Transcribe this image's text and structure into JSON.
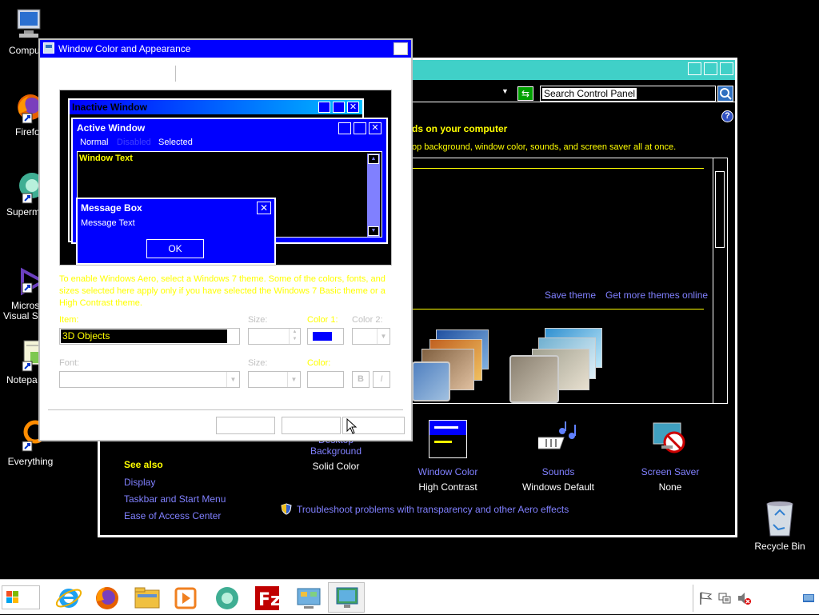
{
  "desktop": {
    "icons": [
      {
        "label": "Compu"
      },
      {
        "label": "Firefo"
      },
      {
        "label": "Superm"
      },
      {
        "label": "Micros"
      },
      {
        "label": "Visual S"
      },
      {
        "label": "Notepa"
      },
      {
        "label": "Everything"
      },
      {
        "label": "Recycle Bin"
      }
    ]
  },
  "control_panel": {
    "search_placeholder": "Search Control Panel",
    "heading_fragment": "ds on your computer",
    "subheading_fragment": "op background, window color, sounds, and screen saver all at once.",
    "save_theme": "Save theme",
    "get_more_themes": "Get more themes online",
    "see_also": {
      "title": "See also",
      "links": [
        "Display",
        "Taskbar and Start Menu",
        "Ease of Access Center"
      ]
    },
    "bottom_items": [
      {
        "title": "Desktop Background",
        "value": "Solid Color"
      },
      {
        "title": "Window Color",
        "value": "High Contrast"
      },
      {
        "title": "Sounds",
        "value": "Windows Default"
      },
      {
        "title": "Screen Saver",
        "value": "None"
      }
    ],
    "troubleshoot": "Troubleshoot problems with transparency and other Aero effects",
    "help_glyph": "?"
  },
  "dialog": {
    "title": "Window Color and Appearance",
    "preview": {
      "inactive_title": "Inactive Window",
      "active_title": "Active Window",
      "menu_normal": "Normal",
      "menu_disabled": "Disabled",
      "menu_selected": "Selected",
      "window_text": "Window Text",
      "msgbox_title": "Message Box",
      "msgbox_text": "Message Text",
      "ok_label": "OK"
    },
    "info_text": "To enable Windows Aero, select a Windows 7 theme. Some of the colors, fonts, and sizes selected here apply only if you have selected the Windows 7 Basic theme or a High Contrast theme.",
    "item_label": "Item:",
    "item_value": "3D Objects",
    "size_label": "Size:",
    "color1_label": "Color 1:",
    "color2_label": "Color 2:",
    "font_label": "Font:",
    "font_size_label": "Size:",
    "font_color_label": "Color:",
    "bold_label": "B",
    "italic_label": "I",
    "colors": {
      "color1": "#0000ff"
    }
  },
  "colors": {
    "accent_yellow": "#ffff00",
    "link_blue": "#8080ff",
    "title_blue": "#0000ff",
    "cp_titlebar": "#40d0c8"
  }
}
